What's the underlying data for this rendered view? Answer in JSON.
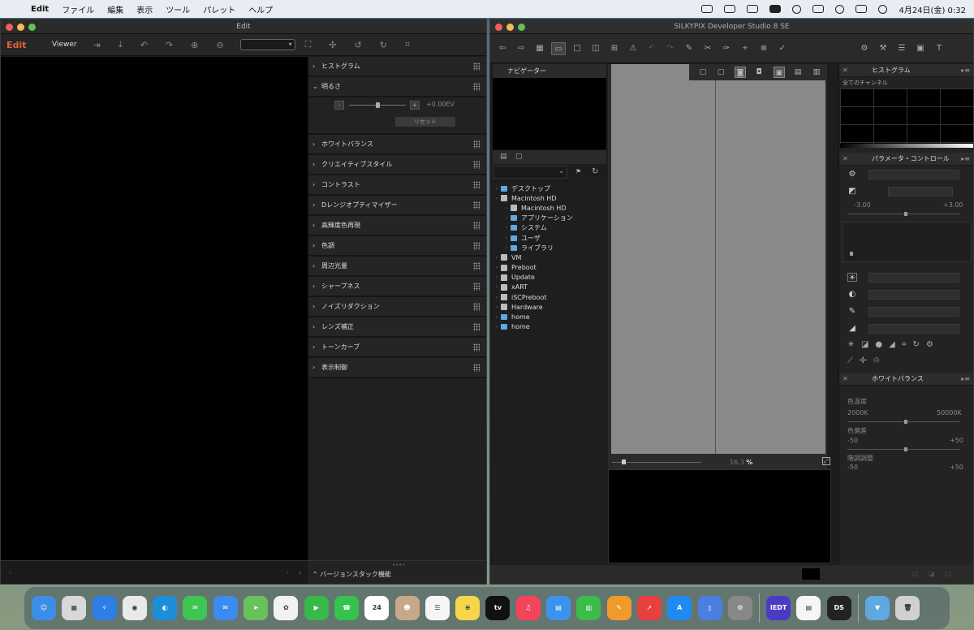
{
  "menubar": {
    "app_name": "Edit",
    "items": [
      "ファイル",
      "編集",
      "表示",
      "ツール",
      "パレット",
      "ヘルプ"
    ],
    "clock": "4月24日(金)  0:32"
  },
  "left_window": {
    "title": "Edit",
    "mode_label": "Edit",
    "viewer_label": "Viewer",
    "panel_items": [
      "ヒストグラム",
      "明るさ",
      "ホワイトバランス",
      "クリエイティブスタイル",
      "コントラスト",
      "Dレンジオプティマイザー",
      "高輝度色再現",
      "色調",
      "周辺光量",
      "シャープネス",
      "ノイズリダクション",
      "レンズ補正",
      "トーンカーブ",
      "表示制御"
    ],
    "brightness": {
      "minus": "-",
      "plus": "+",
      "value": "+0.00EV",
      "reset": "リセット"
    },
    "version_stack": "バージョンスタック機能"
  },
  "right_window": {
    "title": "SILKYPIX Developer Studio 8 SE",
    "navigator": "ナビゲーター",
    "tree": [
      {
        "label": "デスクトップ",
        "type": "folder",
        "indent": 1
      },
      {
        "label": "Macintosh HD",
        "type": "disk",
        "indent": 1
      },
      {
        "label": "Macintosh HD",
        "type": "disk",
        "indent": 2
      },
      {
        "label": "アプリケーション",
        "type": "folder",
        "indent": 2
      },
      {
        "label": "システム",
        "type": "folder",
        "indent": 2
      },
      {
        "label": "ユーザ",
        "type": "folder",
        "indent": 2
      },
      {
        "label": "ライブラリ",
        "type": "folder",
        "indent": 2
      },
      {
        "label": "VM",
        "type": "disk",
        "indent": 1
      },
      {
        "label": "Preboot",
        "type": "disk",
        "indent": 1
      },
      {
        "label": "Update",
        "type": "disk",
        "indent": 1
      },
      {
        "label": "xART",
        "type": "disk",
        "indent": 1
      },
      {
        "label": "iSCPreboot",
        "type": "disk",
        "indent": 1
      },
      {
        "label": "Hardware",
        "type": "disk",
        "indent": 1
      },
      {
        "label": "home",
        "type": "folder",
        "indent": 1
      },
      {
        "label": "home",
        "type": "folder",
        "indent": 1
      }
    ],
    "zoom_value": "16.3",
    "zoom_unit": "%",
    "histogram": {
      "title": "ヒストグラム",
      "channel": "全てのチャンネル"
    },
    "param_control": {
      "title": "パラメータ・コントロール",
      "exposure_min": "-3.00",
      "exposure_max": "+3.00"
    },
    "white_balance": {
      "title": "ホワイトバランス",
      "temp_label": "色温度",
      "temp_min": "2000K",
      "temp_max": "50000K",
      "dev_label": "色偏差",
      "dev_min": "-50",
      "dev_max": "+50",
      "tint_label": "階調調整",
      "tint_min": "-50",
      "tint_max": "+50"
    }
  },
  "dock": {
    "apps": [
      {
        "name": "Finder",
        "color": "#3a8ee6",
        "glyph": "☺"
      },
      {
        "name": "Launchpad",
        "color": "#d8d8d8",
        "glyph": "▦"
      },
      {
        "name": "Safari",
        "color": "#2d7fe6",
        "glyph": "✧"
      },
      {
        "name": "Chrome",
        "color": "#e9e9e9",
        "glyph": "◉"
      },
      {
        "name": "Edge",
        "color": "#1d8fd8",
        "glyph": "◐"
      },
      {
        "name": "Messages",
        "color": "#3ec552",
        "glyph": "✉"
      },
      {
        "name": "Mail",
        "color": "#3b8bf0",
        "glyph": "✉"
      },
      {
        "name": "Maps",
        "color": "#68c25a",
        "glyph": "➤"
      },
      {
        "name": "Photos",
        "color": "#f2f2f2",
        "glyph": "✿"
      },
      {
        "name": "FaceTime",
        "color": "#36b94a",
        "glyph": "▶"
      },
      {
        "name": "Phone",
        "color": "#35c24e",
        "glyph": "☎"
      },
      {
        "name": "Calendar",
        "color": "#ffffff",
        "glyph": "24"
      },
      {
        "name": "Contacts",
        "color": "#c7a98a",
        "glyph": "☻"
      },
      {
        "name": "Reminders",
        "color": "#f5f5f5",
        "glyph": "☰"
      },
      {
        "name": "Notes",
        "color": "#f6d64a",
        "glyph": "≡"
      },
      {
        "name": "TV",
        "color": "#111111",
        "glyph": "tv"
      },
      {
        "name": "Music",
        "color": "#f2445b",
        "glyph": "♫"
      },
      {
        "name": "Keynote",
        "color": "#3b93f0",
        "glyph": "▤"
      },
      {
        "name": "Numbers",
        "color": "#3cbc4a",
        "glyph": "▥"
      },
      {
        "name": "Pages",
        "color": "#f09a2c",
        "glyph": "✎"
      },
      {
        "name": "Rocket",
        "color": "#e84040",
        "glyph": "➚"
      },
      {
        "name": "App Store",
        "color": "#1f8af0",
        "glyph": "A"
      },
      {
        "name": "Simulator",
        "color": "#4a7fe0",
        "glyph": "▯"
      },
      {
        "name": "System Preferences",
        "color": "#888888",
        "glyph": "⚙"
      }
    ],
    "apps_right": [
      {
        "name": "IEDT",
        "color": "#4b3ac4",
        "glyph": "IEDT"
      },
      {
        "name": "Preview",
        "color": "#f5f5f5",
        "glyph": "▤"
      },
      {
        "name": "DS",
        "color": "#222222",
        "glyph": "DS"
      }
    ],
    "trash_apps": [
      {
        "name": "Downloads",
        "color": "#5fa8e0",
        "glyph": "▼"
      },
      {
        "name": "Trash",
        "color": "#d0d0d0",
        "glyph": "🗑"
      }
    ]
  }
}
